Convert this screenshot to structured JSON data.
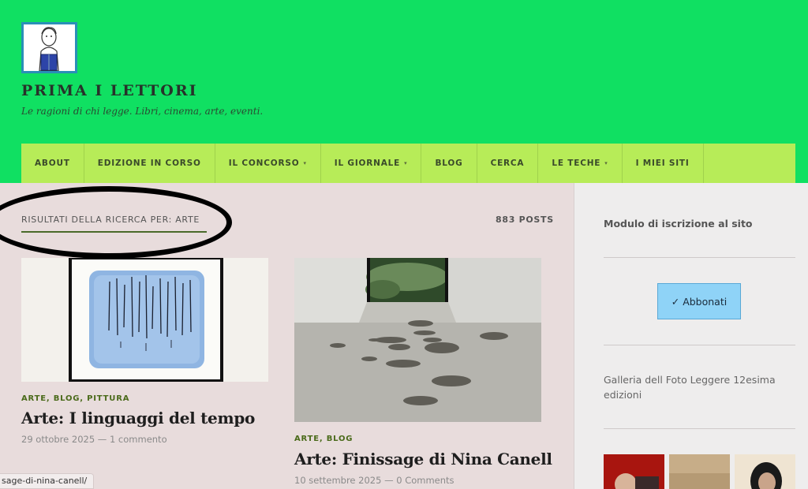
{
  "site": {
    "title": "PRIMA I LETTORI",
    "tagline": "Le ragioni di chi legge. Libri, cinema, arte, eventi."
  },
  "nav": {
    "items": [
      {
        "label": "ABOUT",
        "has_dropdown": false
      },
      {
        "label": "EDIZIONE IN CORSO",
        "has_dropdown": false
      },
      {
        "label": "IL CONCORSO",
        "has_dropdown": true
      },
      {
        "label": "IL GIORNALE",
        "has_dropdown": true
      },
      {
        "label": "BLOG",
        "has_dropdown": false
      },
      {
        "label": "CERCA",
        "has_dropdown": false
      },
      {
        "label": "LE TECHE",
        "has_dropdown": true
      },
      {
        "label": "I MIEI SITI",
        "has_dropdown": false
      }
    ],
    "dropdown_icon": "▾"
  },
  "search": {
    "label": "RISULTATI DELLA RICERCA PER: ARTE",
    "count": "883 POSTS"
  },
  "posts": [
    {
      "categories": "ARTE, BLOG, PITTURA",
      "title": "Arte: I linguaggi del tempo",
      "meta": "29 ottobre 2025 — 1 commento",
      "image_icon": "blue-drawing-artwork-image"
    },
    {
      "categories": "ARTE, BLOG",
      "title": "Arte: Finissage di Nina Canell",
      "meta": "10 settembre 2025 — 0 Comments",
      "image_icon": "gallery-installation-image"
    }
  ],
  "sidebar": {
    "heading": "Modulo di iscrizione al sito",
    "subscribe_label": "✓ Abbonati",
    "gallery_text": "Galleria dell Foto Leggere 12esima edizioni"
  },
  "status_bar": {
    "url": "sage-di-nina-canell/"
  },
  "colors": {
    "header_bg": "#10e062",
    "nav_bg": "#b7ec58",
    "main_bg": "#e8dcdc",
    "sidebar_bg": "#eeeded",
    "button_bg": "#8fd3f7",
    "category_color": "#4a6a1a"
  }
}
